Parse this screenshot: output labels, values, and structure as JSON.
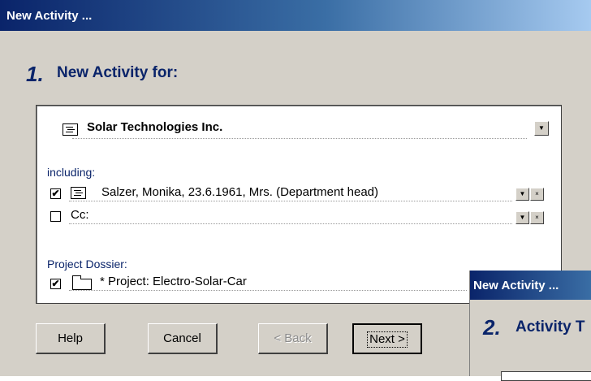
{
  "dialog": {
    "title": "New Activity ...",
    "step_number": "1.",
    "step_title": "New Activity for:"
  },
  "company": {
    "name": "Solar Technologies Inc."
  },
  "including": {
    "label": "including:",
    "contact": {
      "checked": true,
      "text": "Salzer, Monika, 23.6.1961, Mrs.  (Department head)"
    },
    "cc": {
      "checked": false,
      "text": "Cc:"
    }
  },
  "project": {
    "label": "Project Dossier:",
    "checked": true,
    "text": "* Project: Electro-Solar-Car"
  },
  "buttons": {
    "help": "Help",
    "cancel": "Cancel",
    "back": "< Back",
    "next": "Next >"
  },
  "glyphs": {
    "dropdown": "▼",
    "close": "×",
    "check": "✔"
  },
  "dialog2": {
    "title": "New Activity ...",
    "step_number": "2.",
    "step_title": "Activity T"
  }
}
